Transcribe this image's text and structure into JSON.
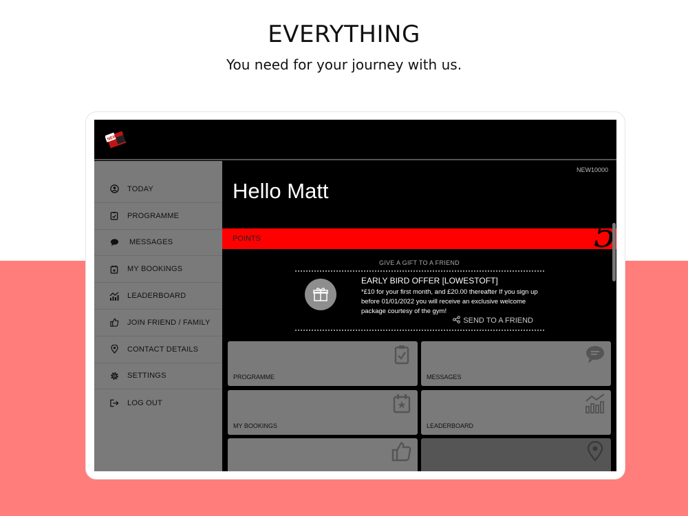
{
  "headline": "EVERYTHING",
  "subline": "You need for your journey with us.",
  "colors": {
    "accent": "#ff0000",
    "background_band": "#ff7d7b",
    "sidebar": "#7a7a7a",
    "screen": "#000000"
  },
  "app": {
    "logo_icon": "brand-logo",
    "member_code": "NEW10000",
    "greeting": "Hello Matt",
    "points": {
      "label": "POINTS",
      "value": "5"
    }
  },
  "sidebar": {
    "items": [
      {
        "label": "TODAY",
        "icon": "person-circle-icon"
      },
      {
        "label": "PROGRAMME",
        "icon": "clipboard-check-icon"
      },
      {
        "label": "MESSAGES",
        "icon": "chat-bubble-icon"
      },
      {
        "label": "MY BOOKINGS",
        "icon": "calendar-star-icon"
      },
      {
        "label": "LEADERBOARD",
        "icon": "bar-chart-icon"
      },
      {
        "label": "JOIN FRIEND / FAMILY",
        "icon": "thumbs-up-icon"
      },
      {
        "label": "CONTACT DETAILS",
        "icon": "map-pin-icon"
      },
      {
        "label": "SETTINGS",
        "icon": "gear-icon"
      },
      {
        "label": "LOG OUT",
        "icon": "logout-icon"
      }
    ]
  },
  "gift": {
    "title": "GIVE A GIFT TO A FRIEND",
    "offer_title": "EARLY BIRD OFFER [LOWESTOFT]",
    "offer_desc": "*£10 for your first month, and £20.00 thereafter If you sign up before 01/01/2022 you will receive an exclusive welcome package courtesy of the gym!",
    "send_label": "SEND TO A FRIEND"
  },
  "tiles": [
    {
      "label": "PROGRAMME",
      "icon": "clipboard-check-icon"
    },
    {
      "label": "MESSAGES",
      "icon": "chat-bubble-icon"
    },
    {
      "label": "MY BOOKINGS",
      "icon": "calendar-star-icon"
    },
    {
      "label": "LEADERBOARD",
      "icon": "bar-chart-icon"
    },
    {
      "label": "",
      "icon": "thumbs-up-icon"
    },
    {
      "label": "",
      "icon": "map-pin-icon"
    }
  ]
}
